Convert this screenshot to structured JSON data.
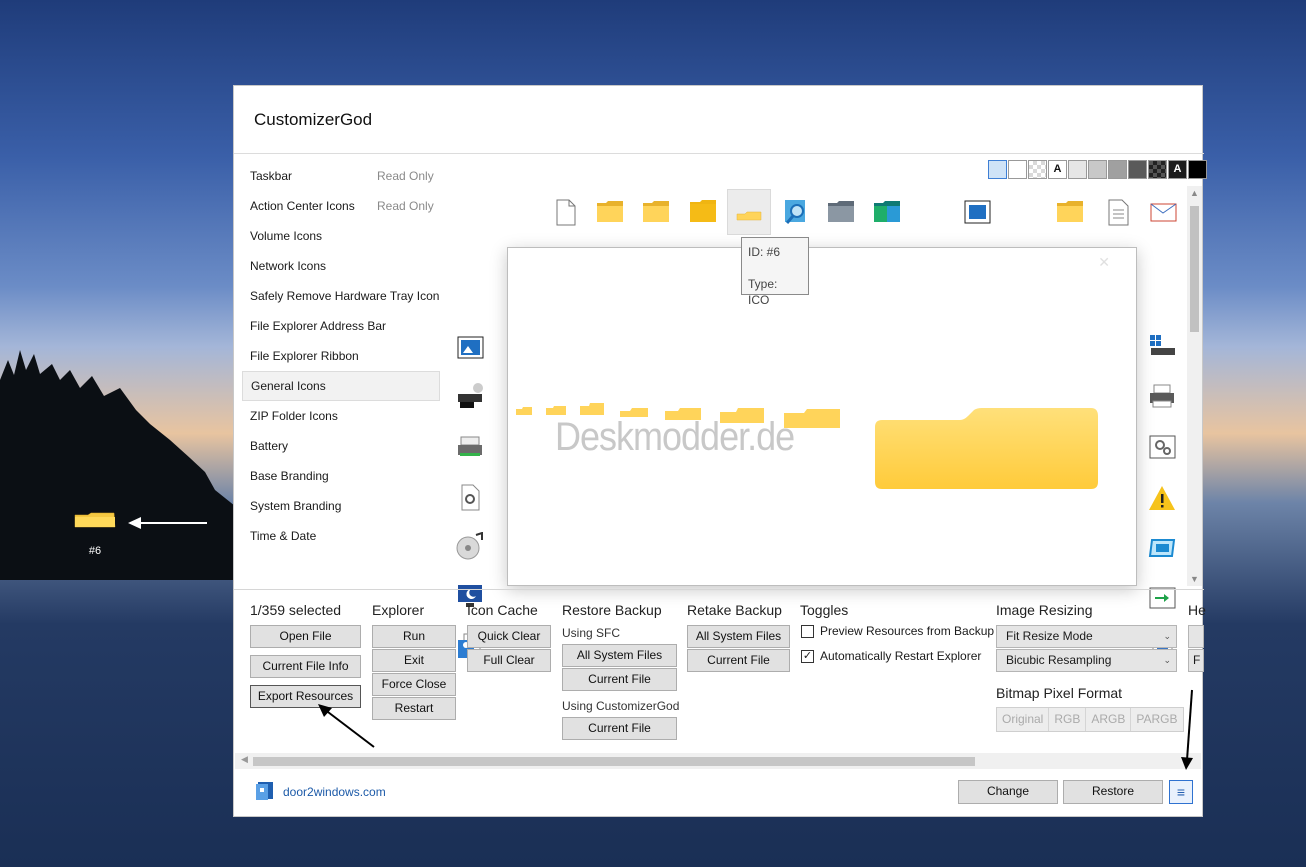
{
  "desktop": {
    "icon_label": "#6"
  },
  "app": {
    "title": "CustomizerGod"
  },
  "sidebar": {
    "items": [
      {
        "label": "Taskbar",
        "badge": "Read Only"
      },
      {
        "label": "Action Center Icons",
        "badge": "Read Only"
      },
      {
        "label": "Volume Icons"
      },
      {
        "label": "Network Icons"
      },
      {
        "label": "Safely Remove Hardware Tray Icon"
      },
      {
        "label": "File Explorer Address Bar"
      },
      {
        "label": "File Explorer Ribbon"
      },
      {
        "label": "General Icons",
        "selected": true
      },
      {
        "label": "ZIP Folder Icons"
      },
      {
        "label": "Battery"
      },
      {
        "label": "Base Branding"
      },
      {
        "label": "System Branding"
      },
      {
        "label": "Time & Date"
      }
    ]
  },
  "palette": {
    "letter_a": "A",
    "letter_a_dark": "A"
  },
  "tooltip": {
    "id": "ID: #6",
    "type": "Type: ICO"
  },
  "preview": {
    "watermark": "Deskmodder.de"
  },
  "selection": {
    "count": "1/359 selected",
    "open_file": "Open File",
    "current_file_info": "Current File Info",
    "export_resources": "Export Resources"
  },
  "explorer": {
    "title": "Explorer",
    "run": "Run",
    "exit": "Exit",
    "force_close": "Force Close",
    "restart": "Restart"
  },
  "icon_cache": {
    "title": "Icon Cache",
    "quick_clear": "Quick Clear",
    "full_clear": "Full Clear"
  },
  "restore_backup": {
    "title": "Restore Backup",
    "using_sfc": "Using SFC",
    "all_system_files": "All System Files",
    "current_file": "Current File",
    "using_cg": "Using CustomizerGod",
    "current_file_2": "Current File"
  },
  "retake_backup": {
    "title": "Retake Backup",
    "all_system_files": "All System Files",
    "current_file": "Current File"
  },
  "toggles": {
    "title": "Toggles",
    "preview_label": "Preview Resources from Backup",
    "preview_checked": false,
    "restart_label": "Automatically Restart Explorer",
    "restart_checked": true,
    "check_mark": "✓"
  },
  "image_resizing": {
    "title": "Image Resizing",
    "mode": "Fit Resize Mode",
    "resampling": "Bicubic Resampling",
    "cut_title": "He",
    "cut_value": "F"
  },
  "bitmap": {
    "title": "Bitmap Pixel Format",
    "options": [
      "Original",
      "RGB",
      "ARGB",
      "PARGB"
    ]
  },
  "footer": {
    "link": "door2windows.com",
    "change": "Change",
    "restore": "Restore",
    "menu_glyph": "≡"
  }
}
